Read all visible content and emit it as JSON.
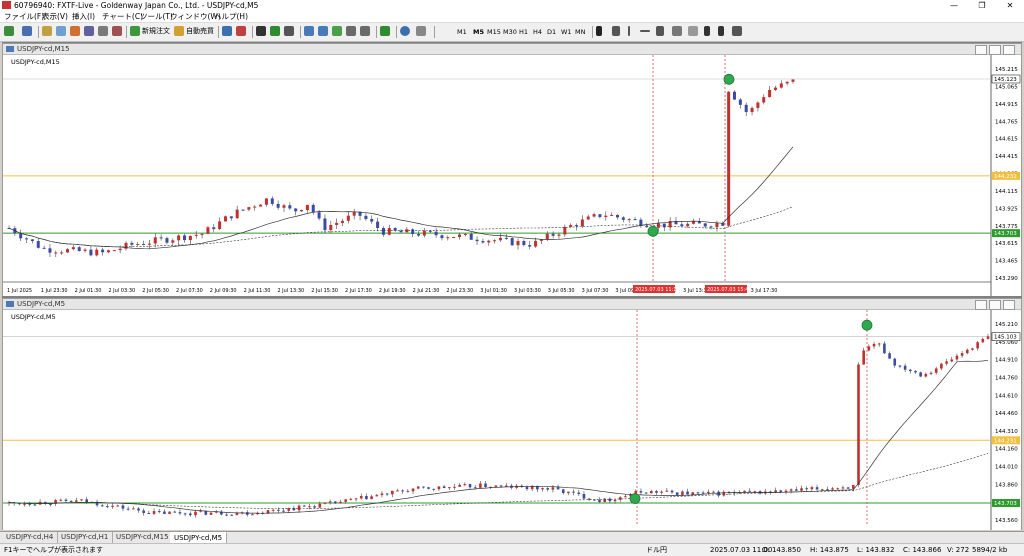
{
  "window": {
    "title": "60796940: FXTF-Live - Goldenway Japan Co., Ltd. - USDJPY-cd,M5",
    "buttons": [
      "—",
      "❐",
      "✕"
    ]
  },
  "menu": [
    "ファイル(F)",
    "表示(V)",
    "挿入(I)",
    "チャート(C)",
    "ツール(T)",
    "ウィンドウ(W)",
    "ヘルプ(H)"
  ],
  "toolbar": {
    "new_order": "新規注文",
    "auto_trade": "自動売買",
    "timeframes": [
      "M1",
      "M5",
      "M15",
      "M30",
      "H1",
      "H4",
      "D1",
      "W1",
      "MN"
    ],
    "active_timeframe": "M5"
  },
  "colors": {
    "bull": "#c22f2f",
    "bear": "#3a4aa8",
    "yellow_line": "#f2c040",
    "green_line": "#2e9b2e",
    "vline": "#e05050",
    "marker": "#2fa84f"
  },
  "chart1": {
    "window_title": "USDJPY-cd,M15",
    "label": "USDJPY-cd,M15",
    "price_ticks": [
      "145.215",
      "145.065",
      "144.915",
      "144.765",
      "144.615",
      "144.415",
      "144.265",
      "144.115",
      "143.925",
      "143.775",
      "143.615",
      "143.465",
      "143.290"
    ],
    "current_price": "145.123",
    "yellow_price": "144.231",
    "green_price": "143.703",
    "time_ticks": [
      "1 Jul 2025",
      "1 Jul 23:30",
      "2 Jul 01:30",
      "2 Jul 03:30",
      "2 Jul 05:30",
      "2 Jul 07:30",
      "2 Jul 09:30",
      "2 Jul 11:30",
      "2 Jul 13:30",
      "2 Jul 15:30",
      "2 Jul 17:30",
      "2 Jul 19:30",
      "2 Jul 21:30",
      "2 Jul 23:30",
      "3 Jul 01:30",
      "3 Jul 03:30",
      "3 Jul 05:30",
      "3 Jul 07:30",
      "3 Jul 09:30",
      "3 Jul 11:30",
      "3 Jul 13:30",
      "3 Jul 15:30",
      "3 Jul 17:30"
    ],
    "vline_labels": [
      "2025.07.03 11:15",
      "2025.07.03 15:45"
    ]
  },
  "chart2": {
    "window_title": "USDJPY-cd,M5",
    "label": "USDJPY-cd,M5",
    "price_ticks": [
      "145.210",
      "145.060",
      "144.910",
      "144.760",
      "144.610",
      "144.460",
      "144.310",
      "144.160",
      "144.010",
      "143.860",
      "143.710",
      "143.560"
    ],
    "current_price": "145.103",
    "yellow_price": "144.231",
    "green_price": "143.703"
  },
  "tabs": [
    "USDJPY-cd,H4",
    "USDJPY-cd,H1",
    "USDJPY-cd,M15",
    "USDJPY-cd,M5"
  ],
  "active_tab": "USDJPY-cd,M5",
  "status": {
    "help": "F1キーでヘルプが表示されます",
    "currency": "ドル円",
    "datetime": "2025.07.03 11:00",
    "open": "O: 143.850",
    "high": "H: 143.875",
    "low": "L: 143.832",
    "close": "C: 143.866",
    "volume": "V: 272",
    "traffic": "5894/2 kb"
  }
}
